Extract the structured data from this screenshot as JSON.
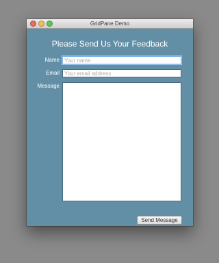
{
  "window": {
    "title": "GridPane Demo",
    "controls": {
      "close": "close-icon",
      "minimize": "minimize-icon",
      "maximize": "maximize-icon"
    },
    "colors": {
      "background": "#638fa6",
      "close": "#ee6a5f",
      "minimize": "#f5c04f",
      "maximize": "#62c655"
    }
  },
  "form": {
    "heading": "Please Send Us Your Feedback",
    "name": {
      "label": "Name",
      "value": "",
      "placeholder": "Your name"
    },
    "email": {
      "label": "Email",
      "value": "",
      "placeholder": "Your email address"
    },
    "message": {
      "label": "Message",
      "value": ""
    },
    "submit_label": "Send Message"
  }
}
